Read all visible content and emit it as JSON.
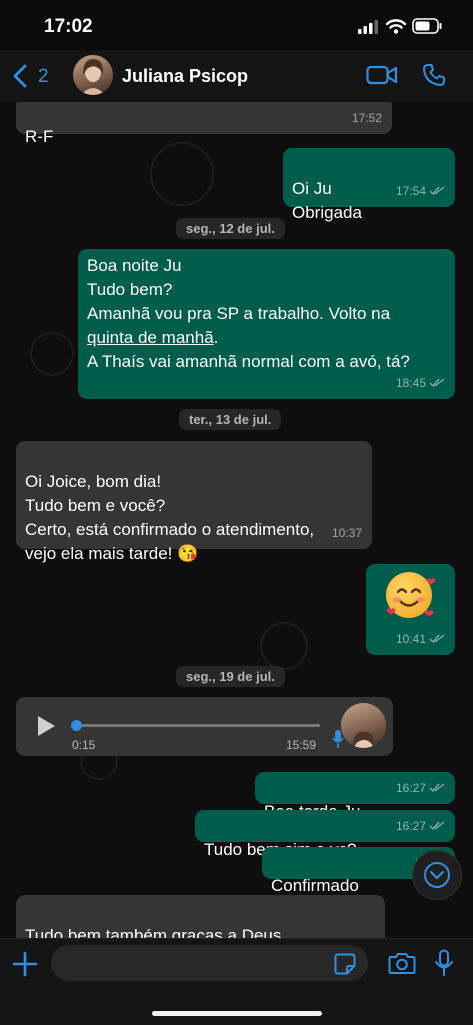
{
  "status": {
    "time": "17:02"
  },
  "header": {
    "back_count": "2",
    "contact_name": "Juliana Psicop"
  },
  "chat": {
    "messages": [
      {
        "text": "R-F",
        "time": "17:52"
      },
      {
        "text": "Oi Ju\nObrigada",
        "time": "17:54"
      },
      {
        "line1": "Boa noite Ju",
        "line2": "Tudo bem?",
        "line3a": "Amanhã vou pra SP a trabalho. Volto na",
        "line3b": "quinta de manhã",
        "line3c": ".",
        "line4": "A Thaís vai amanhã normal com a avó, tá?",
        "time": "18:45"
      },
      {
        "text": "Oi Joice, bom dia!\nTudo bem e você?\nCerto, está confirmado o atendimento,\nvejo ela mais tarde! 😘",
        "time": "10:37"
      },
      {
        "time": "10:41"
      },
      {
        "elapsed": "0:15",
        "duration": "15:59",
        "progress": 0.0
      },
      {
        "text": "Boa tarde Ju",
        "time": "16:27"
      },
      {
        "text": "Tudo bem sim e vc?",
        "time": "16:27"
      },
      {
        "text": "Confirmado",
        "time": "16:27"
      },
      {
        "text": "Tudo bem também graças a Deus,\nconfirmado 🥰"
      }
    ],
    "dates": [
      "seg., 12 de jul.",
      "ter., 13 de jul.",
      "seg., 19 de jul."
    ]
  },
  "composer": {
    "placeholder": ""
  },
  "colors": {
    "accent": "#2f8fe0",
    "outgoing": "#005c4b",
    "incoming": "#353535",
    "read_ticks": "#8aa7b8"
  },
  "icons": [
    "back-chevron-icon",
    "video-call-icon",
    "phone-call-icon",
    "play-icon",
    "microphone-icon",
    "plus-icon",
    "sticker-icon",
    "camera-icon",
    "scroll-down-icon"
  ]
}
